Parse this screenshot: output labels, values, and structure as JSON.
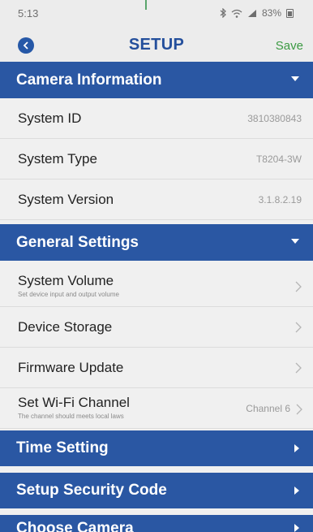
{
  "status": {
    "time": "5:13",
    "battery": "83%"
  },
  "header": {
    "title": "SETUP",
    "save_label": "Save"
  },
  "camera_info": {
    "title": "Camera Information",
    "rows": [
      {
        "label": "System ID",
        "value": "3810380843"
      },
      {
        "label": "System Type",
        "value": "T8204-3W"
      },
      {
        "label": "System Version",
        "value": "3.1.8.2.19"
      }
    ]
  },
  "general": {
    "title": "General Settings",
    "system_volume": {
      "label": "System Volume",
      "sub": "Set device input and output volume"
    },
    "device_storage": {
      "label": "Device Storage"
    },
    "firmware_update": {
      "label": "Firmware Update"
    },
    "wifi_channel": {
      "label": "Set Wi-Fi Channel",
      "sub": "The channel should meets local laws",
      "value": "Channel 6"
    }
  },
  "sections": {
    "time_setting": "Time Setting",
    "security_code": "Setup Security Code",
    "choose_camera": "Choose Camera"
  },
  "colors": {
    "header_blue": "#2a57a3",
    "save_green": "#3c9a43"
  }
}
